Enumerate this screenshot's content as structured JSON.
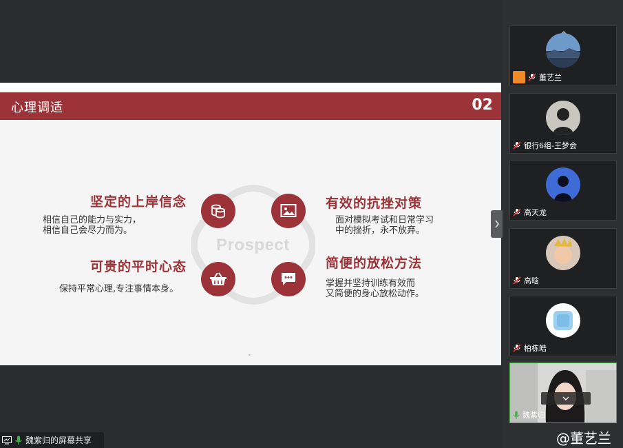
{
  "slide": {
    "title": "心理调适",
    "number": "02",
    "center_text": "Prospect",
    "items": [
      {
        "title": "坚定的上岸信念",
        "desc": "相信自己的能力与实力，\n相信自己会尽力而为。",
        "icon": "coins-icon"
      },
      {
        "title": "有效的抗挫对策",
        "desc": "面对模拟考试和日常学习\n中的挫折，永不放弃。",
        "icon": "image-icon"
      },
      {
        "title": "可贵的平时心态",
        "desc": "保持平常心理,专注事情本身。",
        "icon": "basket-icon"
      },
      {
        "title": "简便的放松方法",
        "desc": "掌握并坚持训练有效而\n又简便的身心放松动作。",
        "icon": "chat-icon"
      }
    ]
  },
  "share_bar": {
    "label": "魏紫归的屏幕共享"
  },
  "participants": [
    {
      "name": "董艺兰",
      "muted": true,
      "host": true
    },
    {
      "name": "银行6组-王梦会",
      "muted": true
    },
    {
      "name": "高天龙",
      "muted": true
    },
    {
      "name": "高晗",
      "muted": true
    },
    {
      "name": "柏栋皓",
      "muted": true
    },
    {
      "name": "魏紫归",
      "muted": false,
      "speaking": true
    }
  ],
  "watermark": "@董艺兰",
  "colors": {
    "accent": "#9b3338",
    "background": "#2b2c2e",
    "panel": "#2e2f31",
    "speaking": "#4caf50"
  }
}
